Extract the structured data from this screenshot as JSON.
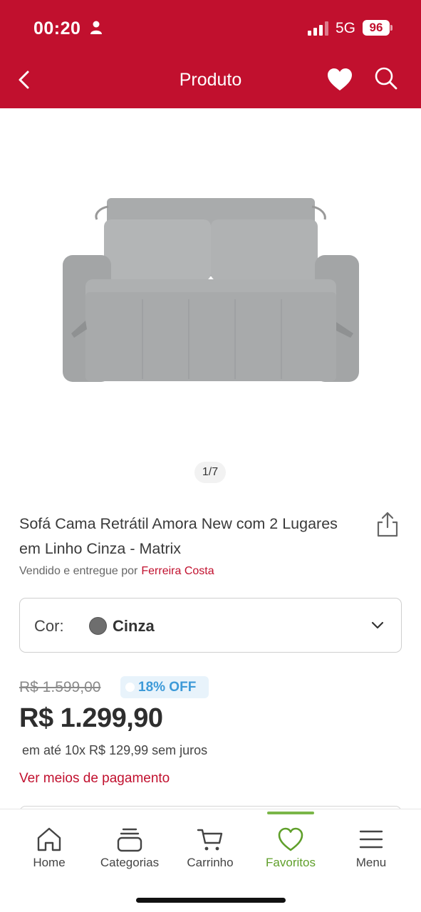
{
  "status_bar": {
    "time": "00:20",
    "network": "5G",
    "battery": "96"
  },
  "header": {
    "title": "Produto",
    "icons": [
      "back-arrow-icon",
      "heart-icon",
      "search-icon"
    ],
    "background_color": "#c1102e"
  },
  "gallery": {
    "pager": "1/7"
  },
  "product": {
    "title": "Sofá Cama Retrátil Amora New com 2 Lugares em Linho Cinza - Matrix",
    "seller_prefix": "Vendido e entregue por",
    "seller_name": "Ferreira Costa"
  },
  "color_option": {
    "label": "Cor:",
    "value": "Cinza",
    "swatch_color": "#6e6e6e"
  },
  "pricing": {
    "old_price": "R$ 1.599,00",
    "discount": "18% OFF",
    "price": "R$ 1.299,90",
    "installments": "em até 10x R$ 129,99 sem juros",
    "payment_link": "Ver meios de pagamento"
  },
  "bottom_nav": {
    "items": [
      {
        "label": "Home",
        "icon": "home-icon"
      },
      {
        "label": "Categorias",
        "icon": "categories-icon"
      },
      {
        "label": "Carrinho",
        "icon": "cart-icon"
      },
      {
        "label": "Favoritos",
        "icon": "heart-outline-icon",
        "active": true
      },
      {
        "label": "Menu",
        "icon": "menu-icon"
      }
    ],
    "active_color": "#5f9f2a"
  }
}
